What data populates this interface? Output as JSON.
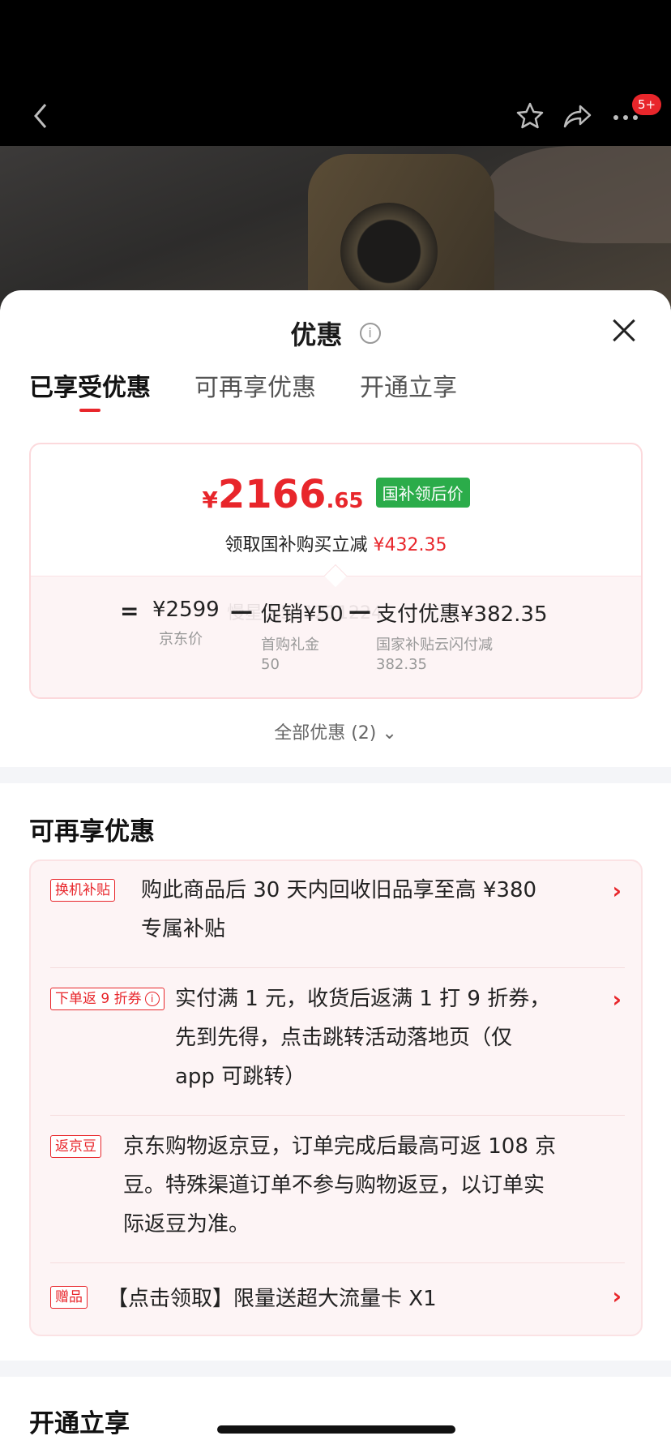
{
  "nav": {
    "back_icon": "chevron-left-icon",
    "badge": "5+"
  },
  "sheet": {
    "title": "优惠",
    "info_glyph": "i"
  },
  "tabs": [
    {
      "label": "已享受优惠"
    },
    {
      "label": "可再享优惠"
    },
    {
      "label": "开通立享"
    }
  ],
  "price": {
    "currency": "¥",
    "integer": "2166",
    "decimal": ".65",
    "tag": "国补领后价",
    "sub_text": "领取国补购买立减",
    "sub_amount": "¥432.35",
    "equals": "=",
    "minus": "—",
    "items": [
      {
        "amount": "¥2599",
        "label": "京东价",
        "value": ""
      },
      {
        "amount": "促销¥50",
        "label": "首购礼金",
        "value": "50"
      },
      {
        "amount": "支付优惠¥382.35",
        "label": "国家补贴云闪付减",
        "value": "382.35"
      }
    ]
  },
  "watermark": "慢星人511211224",
  "all_deals": "全部优惠 (2) ⌄",
  "sections": {
    "more": "可再享优惠",
    "open": "开通立享"
  },
  "deals": [
    {
      "tag": "换机补贴",
      "text_line1": "购此商品后 30 天内回收旧品享至高 ¥380",
      "text_line2": "专属补贴",
      "text_line3": ""
    },
    {
      "tag": "下单返 9 折券",
      "text_line1": "实付满 1 元，收货后返满 1 打 9 折券，",
      "text_line2": "先到先得，点击跳转活动落地页（仅",
      "text_line3": "app 可跳转）"
    },
    {
      "tag": "返京豆",
      "text_line1": "京东购物返京豆，订单完成后最高可返 108 京",
      "text_line2": "豆。特殊渠道订单不参与购物返豆，以订单实",
      "text_line3": "际返豆为准。"
    },
    {
      "tag": "赠品",
      "text_line1": "【点击领取】限量送超大流量卡 X1",
      "text_line2": "",
      "text_line3": ""
    }
  ],
  "colors": {
    "accent": "#e8262b",
    "tag_green": "#2bac4a"
  }
}
